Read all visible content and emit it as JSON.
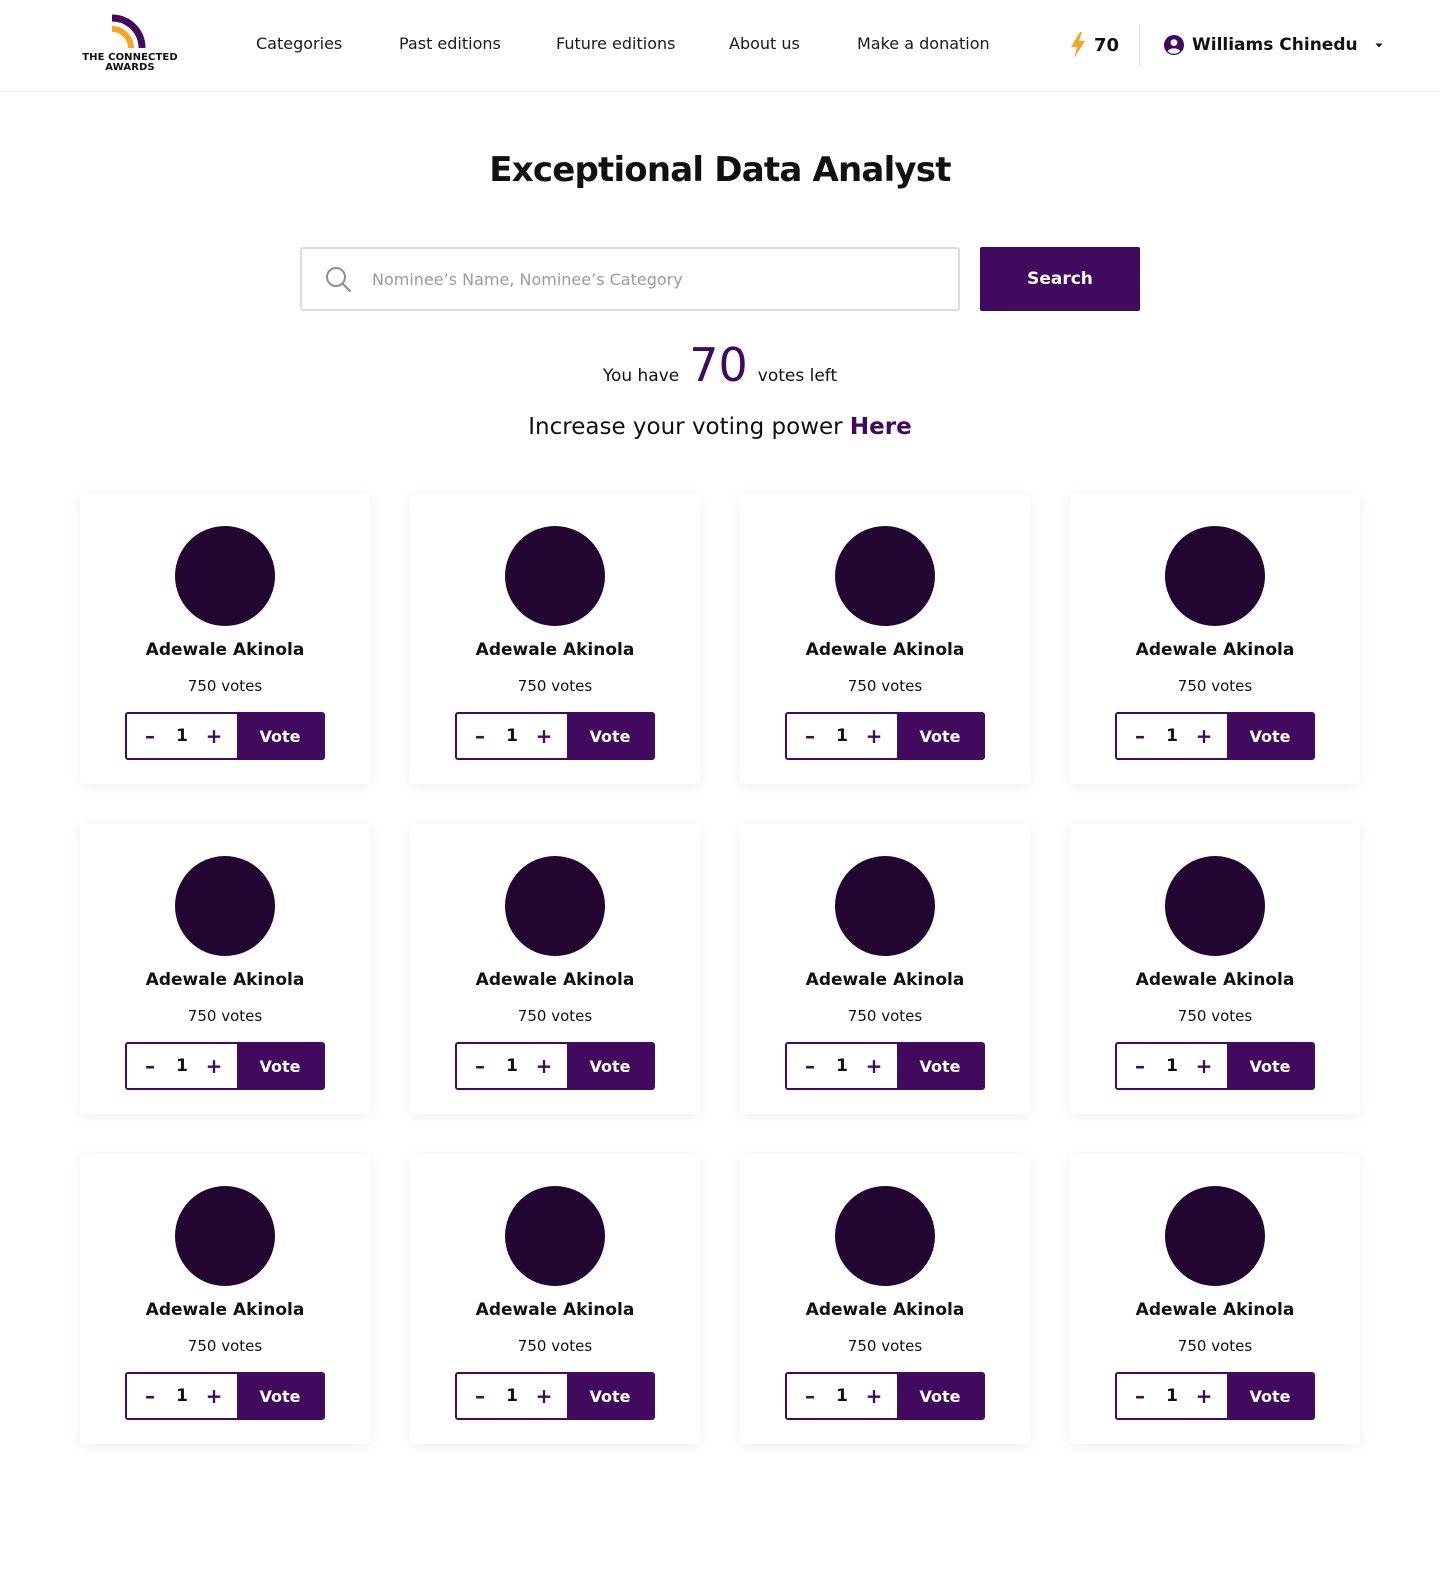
{
  "logo": {
    "line1": "THE CONNECTED",
    "line2": "AWARDS"
  },
  "nav": {
    "items": [
      {
        "label": "Categories"
      },
      {
        "label": "Past editions"
      },
      {
        "label": "Future editions"
      },
      {
        "label": "About us"
      },
      {
        "label": "Make a donation"
      }
    ]
  },
  "header": {
    "energy_icon": "lightning-icon",
    "energy_count": "70",
    "user_icon": "user-circle-icon",
    "user_name": "Williams Chinedu",
    "dropdown_icon": "caret-down-icon"
  },
  "page": {
    "title": "Exceptional Data Analyst",
    "search_placeholder": "Nominee’s Name, Nominee’s Category",
    "search_value": "",
    "search_button": "Search",
    "votes_prefix": "You have",
    "votes_count": "70",
    "votes_suffix": "votes left",
    "increase_text": "Increase your voting power",
    "increase_link": "Here"
  },
  "nominees": [
    {
      "name": "Adewale Akinola",
      "votes": "750 votes",
      "qty": "1",
      "minus": "–",
      "plus": "+",
      "vote_label": "Vote"
    },
    {
      "name": "Adewale Akinola",
      "votes": "750 votes",
      "qty": "1",
      "minus": "–",
      "plus": "+",
      "vote_label": "Vote"
    },
    {
      "name": "Adewale Akinola",
      "votes": "750 votes",
      "qty": "1",
      "minus": "–",
      "plus": "+",
      "vote_label": "Vote"
    },
    {
      "name": "Adewale Akinola",
      "votes": "750 votes",
      "qty": "1",
      "minus": "–",
      "plus": "+",
      "vote_label": "Vote"
    },
    {
      "name": "Adewale Akinola",
      "votes": "750 votes",
      "qty": "1",
      "minus": "–",
      "plus": "+",
      "vote_label": "Vote"
    },
    {
      "name": "Adewale Akinola",
      "votes": "750 votes",
      "qty": "1",
      "minus": "–",
      "plus": "+",
      "vote_label": "Vote"
    },
    {
      "name": "Adewale Akinola",
      "votes": "750 votes",
      "qty": "1",
      "minus": "–",
      "plus": "+",
      "vote_label": "Vote"
    },
    {
      "name": "Adewale Akinola",
      "votes": "750 votes",
      "qty": "1",
      "minus": "–",
      "plus": "+",
      "vote_label": "Vote"
    },
    {
      "name": "Adewale Akinola",
      "votes": "750 votes",
      "qty": "1",
      "minus": "–",
      "plus": "+",
      "vote_label": "Vote"
    },
    {
      "name": "Adewale Akinola",
      "votes": "750 votes",
      "qty": "1",
      "minus": "–",
      "plus": "+",
      "vote_label": "Vote"
    },
    {
      "name": "Adewale Akinola",
      "votes": "750 votes",
      "qty": "1",
      "minus": "–",
      "plus": "+",
      "vote_label": "Vote"
    },
    {
      "name": "Adewale Akinola",
      "votes": "750 votes",
      "qty": "1",
      "minus": "–",
      "plus": "+",
      "vote_label": "Vote"
    }
  ],
  "colors": {
    "brand_purple": "#420a5e",
    "avatar_fill": "#230532",
    "accent_orange": "#f5a623"
  }
}
